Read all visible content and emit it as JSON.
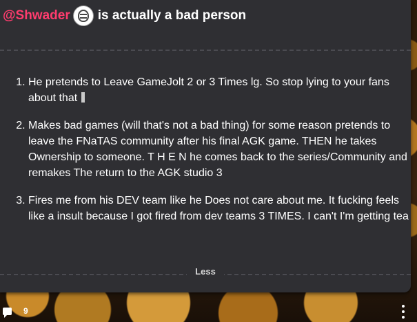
{
  "post": {
    "mention": "@Shwader",
    "headline": "is actually a bad person",
    "items": [
      "He pretends to Leave GameJolt 2 or 3 Times lg. So stop lying to your fans about that",
      "Makes bad games (will that's not a bad thing) for some reason pretends to leave the FNaTAS community after his final AGK game. THEN he takes Ownership to someone. T H E N he comes back to the series/Community and remakes The return to the AGK studio 3",
      "Fires me from his DEV team like he Does not care about me. It fucking feels like a insult because I got fired from dev teams 3 TIMES. I can't I'm getting tea"
    ],
    "less_label": "Less"
  },
  "footer": {
    "comment_count": "9",
    "comment_icon": "comment-icon",
    "more_icon": "more-vertical-icon"
  },
  "colors": {
    "mention": "#ff3c6e",
    "card_bg": "#2f2f33",
    "text": "#ffffff"
  }
}
